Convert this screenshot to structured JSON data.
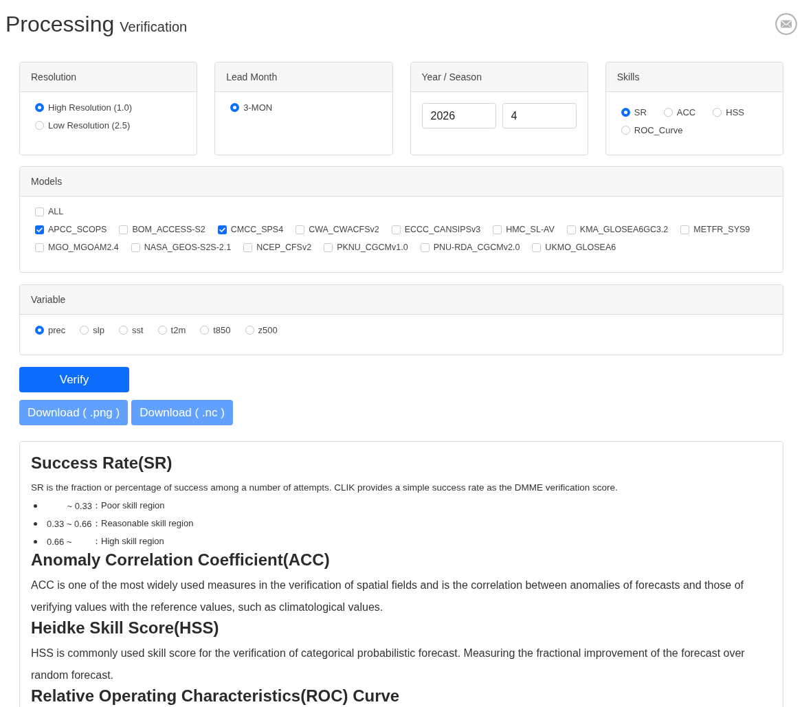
{
  "header": {
    "title": "Processing",
    "subtitle": "Verification"
  },
  "filters": [
    {
      "kind": "radio_list",
      "title": "Resolution",
      "options": [
        {
          "label": "High Resolution (1.0)",
          "selected": true
        },
        {
          "label": "Low Resolution (2.5)",
          "selected": false
        }
      ]
    },
    {
      "kind": "radio_list",
      "title": "Lead Month",
      "options": [
        {
          "label": "3-MON",
          "selected": true
        }
      ]
    },
    {
      "kind": "inputs",
      "title": "Year / Season",
      "fields": [
        {
          "value": "2026"
        },
        {
          "value": "4"
        }
      ]
    },
    {
      "kind": "radio_inline",
      "title": "Skills",
      "options": [
        {
          "label": "SR",
          "selected": true
        },
        {
          "label": "ACC",
          "selected": false
        },
        {
          "label": "HSS",
          "selected": false
        },
        {
          "label": "ROC_Curve",
          "selected": false
        }
      ]
    }
  ],
  "models": {
    "title": "Models",
    "rows": [
      [
        {
          "label": "ALL",
          "checked": false
        }
      ],
      [
        {
          "label": "APCC_SCOPS",
          "checked": true
        },
        {
          "label": "BOM_ACCESS-S2",
          "checked": false
        },
        {
          "label": "CMCC_SPS4",
          "checked": true
        },
        {
          "label": "CWA_CWACFSv2",
          "checked": false
        },
        {
          "label": "ECCC_CANSIPSv3",
          "checked": false
        },
        {
          "label": "HMC_SL-AV",
          "checked": false
        },
        {
          "label": "KMA_GLOSEA6GC3.2",
          "checked": false
        },
        {
          "label": "METFR_SYS9",
          "checked": false
        }
      ],
      [
        {
          "label": "MGO_MGOAM2.4",
          "checked": false
        },
        {
          "label": "NASA_GEOS-S2S-2.1",
          "checked": false
        },
        {
          "label": "NCEP_CFSv2",
          "checked": false
        },
        {
          "label": "PKNU_CGCMv1.0",
          "checked": false
        },
        {
          "label": "PNU-RDA_CGCMv2.0",
          "checked": false
        },
        {
          "label": "UKMO_GLOSEA6",
          "checked": false
        }
      ]
    ]
  },
  "variable": {
    "title": "Variable",
    "options": [
      {
        "label": "prec",
        "selected": true
      },
      {
        "label": "slp",
        "selected": false
      },
      {
        "label": "sst",
        "selected": false
      },
      {
        "label": "t2m",
        "selected": false
      },
      {
        "label": "t850",
        "selected": false
      },
      {
        "label": "z500",
        "selected": false
      }
    ]
  },
  "verify_button": {
    "label": "Verify",
    "disabled": false
  },
  "download_buttons": [
    {
      "label": "Download ( .png )",
      "disabled": true
    },
    {
      "label": "Download ( .nc )",
      "disabled": true
    }
  ],
  "info": {
    "sections": [
      {
        "kind": "list",
        "heading": "Success Rate(SR)",
        "text": "SR is the fraction or percentage of success among a number of attempts. CLIK provides a simple success rate as the DMME verification score.",
        "items": [
          {
            "kind": "upper",
            "range": "~ 0.33",
            "label": "：Poor skill region"
          },
          {
            "kind": "between",
            "range": "0.33 ~ 0.66",
            "label": "：Reasonable skill region"
          },
          {
            "kind": "lower",
            "range": "0.66 ~",
            "label": "：High skill region"
          }
        ]
      },
      {
        "kind": "text",
        "heading": "Anomaly Correlation Coefficient(ACC)",
        "text": "ACC is one of the most widely used measures in the verification of spatial fields and is the correlation between anomalies of forecasts and those of verifying values with the reference values, such as climatological values."
      },
      {
        "kind": "text",
        "heading": "Heidke Skill Score(HSS)",
        "text": "HSS is commonly used skill score for the verification of categorical probabilistic forecast. Measuring the fractional improvement of the forecast over random forecast."
      },
      {
        "kind": "text",
        "heading": "Relative Operating Characteristics(ROC) Curve"
      }
    ]
  }
}
